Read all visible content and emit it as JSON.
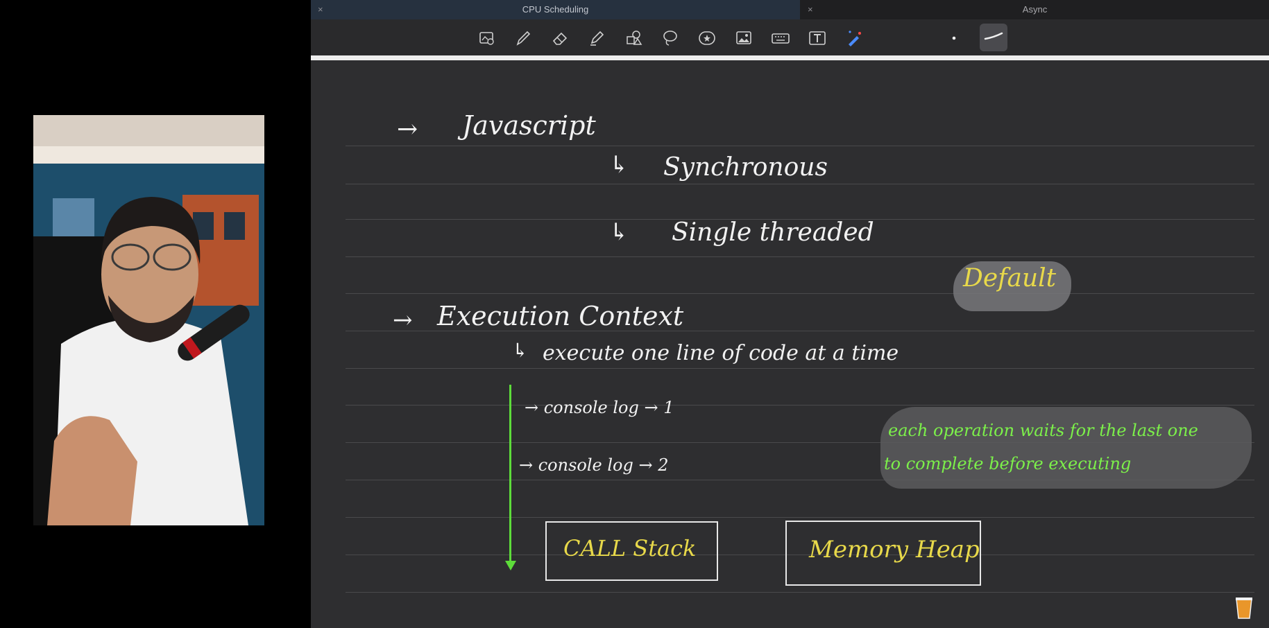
{
  "tabs": [
    {
      "label": "CPU Scheduling",
      "close": "×"
    },
    {
      "label": "Async",
      "close": "×"
    }
  ],
  "toolbar": {
    "tools": [
      "image-text-icon",
      "pen-icon",
      "eraser-icon",
      "highlighter-icon",
      "shapes-icon",
      "lasso-icon",
      "sticker-icon",
      "image-icon",
      "keyboard-icon",
      "text-box-icon",
      "laser-pointer-icon",
      "dot-size-icon",
      "pen-stroke-icon"
    ]
  },
  "notes": {
    "arrow1": "→",
    "javascript": "Javascript",
    "corner1": "↳",
    "synchronous": "Synchronous",
    "corner2": "↳",
    "single_threaded": "Single threaded",
    "default": "Default",
    "arrow2": "→",
    "execution_context": "Execution Context",
    "corner3": "↳",
    "execute_line": "execute one line of code at a time",
    "console1": "→ console log → 1",
    "console2": "→ console log → 2",
    "note_line1": "each operation waits for the last one",
    "note_line2": "to complete before executing",
    "call_stack": "CALL Stack",
    "memory_heap": "Memory Heap"
  },
  "colors": {
    "ink": "#f2f2f2",
    "yellow_ink": "#e8d94a",
    "green_ink": "#7cf04a",
    "canvas_bg": "#2e2e30"
  }
}
